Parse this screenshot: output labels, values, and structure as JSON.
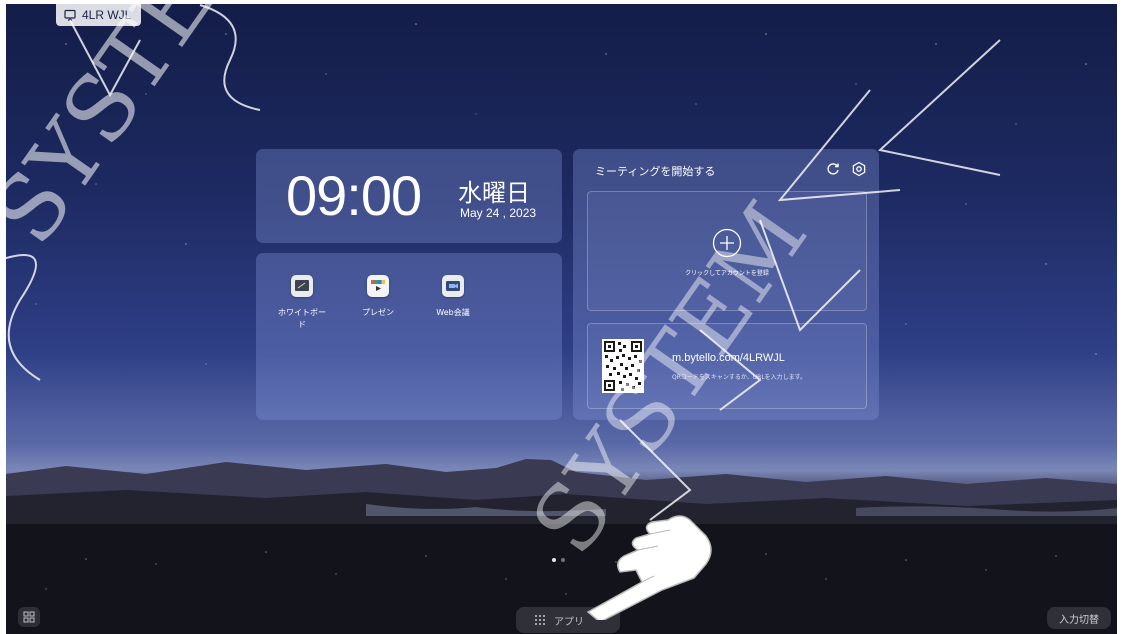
{
  "device_tag": {
    "code": "4LR WJL",
    "icon": "screen-share-icon"
  },
  "clock": {
    "time": "09:00",
    "weekday": "水曜日",
    "date": "May 24 , 2023"
  },
  "apps": [
    {
      "label": "ホワイトボード",
      "icon": "whiteboard-icon"
    },
    {
      "label": "プレゼン",
      "icon": "presentation-icon"
    },
    {
      "label": "Web会議",
      "icon": "web-meeting-icon"
    }
  ],
  "meeting": {
    "title": "ミーティングを開始する",
    "register_text": "クリックしてアカウントを登録",
    "url": "m.bytello.com/4LRWJL",
    "hint": "QRコードをスキャンするか、URLを入力します。"
  },
  "dock": {
    "apps_label": "アプリ",
    "input_switch": "入力切替"
  },
  "watermark_text": "SYSTEM",
  "colors": {
    "sky_top": "#141d48",
    "panel": "#8798dc",
    "accent_apps": [
      "#ef5350",
      "#43a047",
      "#1e88e5",
      "#fbc02d"
    ]
  }
}
